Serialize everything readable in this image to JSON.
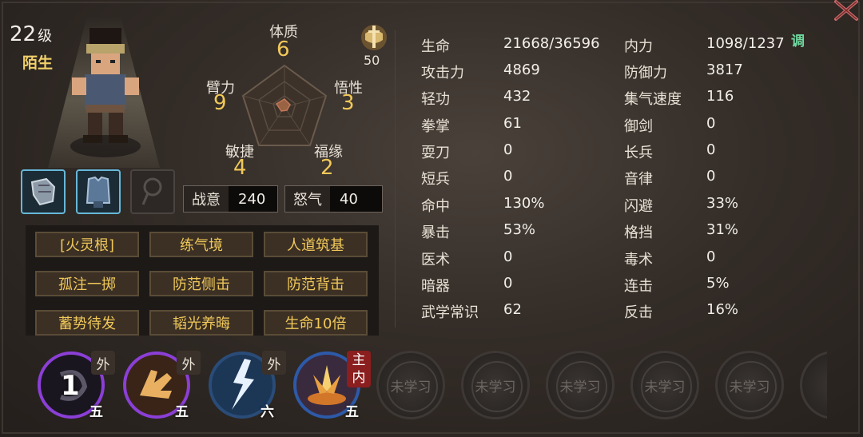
{
  "character": {
    "level": "22",
    "level_suffix": "级",
    "rank": "陌生"
  },
  "attributes": [
    {
      "name": "体质",
      "value": "6"
    },
    {
      "name": "悟性",
      "value": "3"
    },
    {
      "name": "福缘",
      "value": "2"
    },
    {
      "name": "敏捷",
      "value": "4"
    },
    {
      "name": "臂力",
      "value": "9"
    }
  ],
  "emblem": {
    "icon": "sword-emblem-icon",
    "value": "50"
  },
  "meters": [
    {
      "label": "战意",
      "value": "240"
    },
    {
      "label": "怒气",
      "value": "40"
    }
  ],
  "equipment": [
    {
      "icon": "gauntlet-icon",
      "equipped": true
    },
    {
      "icon": "armor-icon",
      "equipped": true
    },
    {
      "icon": "amulet-icon",
      "equipped": false
    }
  ],
  "traits": [
    "[火灵根]",
    "练气境",
    "人道筑基",
    "孤注一掷",
    "防范侧击",
    "防范背击",
    "蓄势待发",
    "韬光养晦",
    "生命10倍"
  ],
  "stats_left": [
    {
      "label": "生命",
      "value": "21668/36596"
    },
    {
      "label": "攻击力",
      "value": "4869"
    },
    {
      "label": "轻功",
      "value": "432"
    },
    {
      "label": "拳掌",
      "value": "61"
    },
    {
      "label": "耍刀",
      "value": "0"
    },
    {
      "label": "短兵",
      "value": "0"
    },
    {
      "label": "命中",
      "value": "130%"
    },
    {
      "label": "暴击",
      "value": "53%"
    },
    {
      "label": "医术",
      "value": "0"
    },
    {
      "label": "暗器",
      "value": "0"
    },
    {
      "label": "武学常识",
      "value": "62"
    }
  ],
  "stats_right": [
    {
      "label": "内力",
      "value": "1098/1237"
    },
    {
      "label": "防御力",
      "value": "3817"
    },
    {
      "label": "集气速度",
      "value": "116"
    },
    {
      "label": "御剑",
      "value": "0"
    },
    {
      "label": "长兵",
      "value": "0"
    },
    {
      "label": "音律",
      "value": "0"
    },
    {
      "label": "闪避",
      "value": "33%"
    },
    {
      "label": "格挡",
      "value": "31%"
    },
    {
      "label": "毒术",
      "value": "0"
    },
    {
      "label": "连击",
      "value": "5%"
    },
    {
      "label": "反击",
      "value": "16%"
    }
  ],
  "tune_label": "调",
  "skills": [
    {
      "tag": "外",
      "rank": "五",
      "number": "1",
      "icon": "dark-swirl-skill-icon"
    },
    {
      "tag": "外",
      "rank": "五",
      "icon": "golden-palm-skill-icon"
    },
    {
      "tag": "外",
      "rank": "六",
      "icon": "lightning-skill-icon"
    },
    {
      "tag": "主",
      "tag2": "内",
      "rank": "五",
      "icon": "flame-burst-skill-icon"
    }
  ],
  "empty_slots": [
    "未学习",
    "未学习",
    "未学习",
    "未学习",
    "未学习",
    "未学"
  ],
  "colors": {
    "gold": "#f0c85a",
    "blue_frame": "#67b7d8",
    "purple_ring": "#8b3fd6",
    "teal": "#6fd9a0"
  }
}
